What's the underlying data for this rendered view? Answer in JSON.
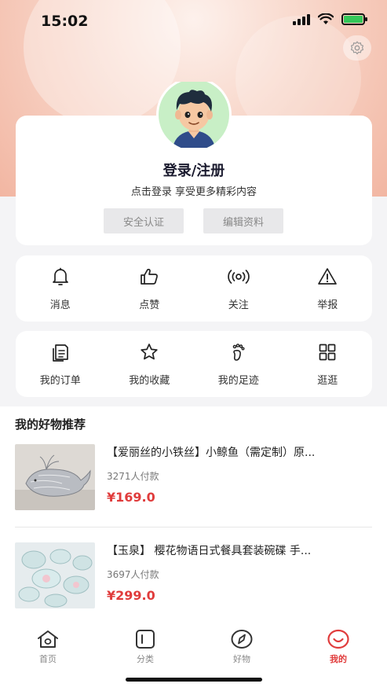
{
  "status_bar": {
    "time": "15:02",
    "battery_color": "#34c759"
  },
  "header": {
    "settings_icon": "gear-icon"
  },
  "profile": {
    "avatar_icon": "user-avatar",
    "title": "登录/注册",
    "subtitle": "点击登录 享受更多精彩内容",
    "security_button": "安全认证",
    "edit_button": "编辑资料"
  },
  "actions_row1": [
    {
      "icon": "bell-icon",
      "label": "消息"
    },
    {
      "icon": "thumbs-up-icon",
      "label": "点赞"
    },
    {
      "icon": "broadcast-icon",
      "label": "关注"
    },
    {
      "icon": "warning-icon",
      "label": "举报"
    }
  ],
  "actions_row2": [
    {
      "icon": "orders-icon",
      "label": "我的订单"
    },
    {
      "icon": "star-icon",
      "label": "我的收藏"
    },
    {
      "icon": "footprint-icon",
      "label": "我的足迹"
    },
    {
      "icon": "grid-icon",
      "label": "逛逛"
    }
  ],
  "recommend": {
    "title": "我的好物推荐",
    "items": [
      {
        "title": "【爱丽丝的小铁丝】小鲸鱼（需定制）原...",
        "sales": "3271人付款",
        "price": "¥169.0"
      },
      {
        "title": "【玉泉】 樱花物语日式餐具套装碗碟 手...",
        "sales": "3697人付款",
        "price": "¥299.0"
      }
    ]
  },
  "tabbar": [
    {
      "icon": "home-icon",
      "label": "首页",
      "active": false
    },
    {
      "icon": "category-icon",
      "label": "分类",
      "active": false
    },
    {
      "icon": "compass-icon",
      "label": "好物",
      "active": false
    },
    {
      "icon": "smile-icon",
      "label": "我的",
      "active": true
    }
  ],
  "colors": {
    "accent": "#e03c3c",
    "hero": "#f2b6a2"
  }
}
